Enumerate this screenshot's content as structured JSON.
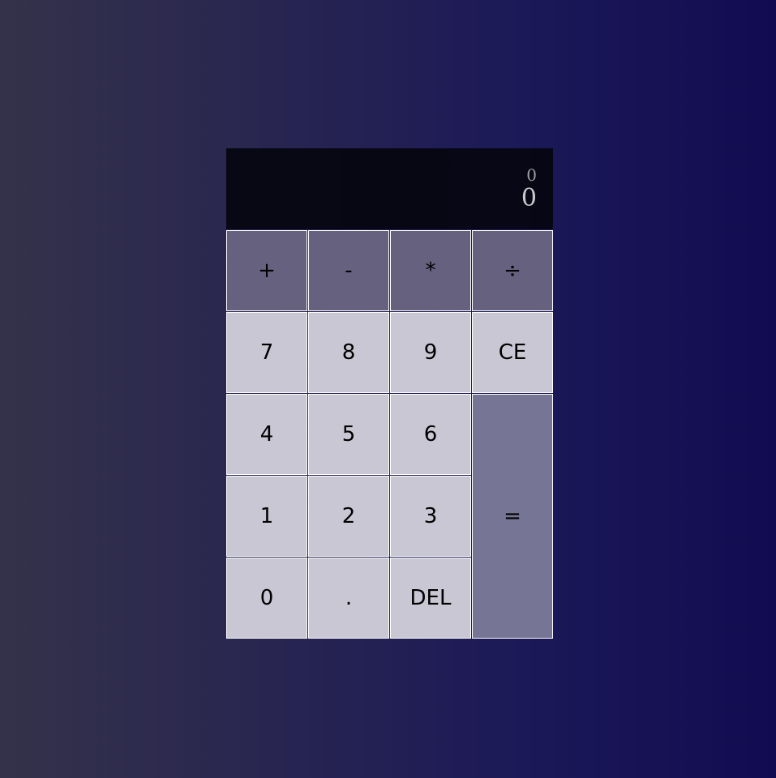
{
  "display": {
    "previous": "0",
    "current": "0"
  },
  "operators": {
    "add": "+",
    "subtract": "-",
    "multiply": "*",
    "divide": "÷"
  },
  "keys": {
    "seven": "7",
    "eight": "8",
    "nine": "9",
    "clear": "CE",
    "four": "4",
    "five": "5",
    "six": "6",
    "one": "1",
    "two": "2",
    "three": "3",
    "equals": "=",
    "zero": "0",
    "decimal": ".",
    "delete": "DEL"
  },
  "colors": {
    "background_left": "#34324a",
    "background_right": "#110c52",
    "display_bg": "#0a0a14",
    "number_key": "#c8c7d3",
    "operator_key": "#65617f",
    "equals_key": "#777595"
  }
}
